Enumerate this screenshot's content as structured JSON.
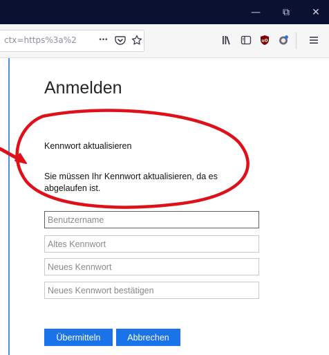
{
  "window": {
    "minimize_glyph": "—",
    "maximize_glyph": "⧉",
    "close_glyph": "✕"
  },
  "nav": {
    "url_text": "ctx=https%3a%2",
    "more_glyph": "•••",
    "icons": [
      "pocket-icon",
      "bookmark-star-icon",
      "library-icon",
      "sidebar-icon",
      "ublock-icon",
      "extension-icon",
      "menu-icon"
    ]
  },
  "page": {
    "title": "Anmelden",
    "subtitle": "Kennwort aktualisieren",
    "message": "Sie müssen Ihr Kennwort aktualisieren, da es abgelaufen ist.",
    "fields": {
      "username_placeholder": "Benutzername",
      "old_password_placeholder": "Altes Kennwort",
      "new_password_placeholder": "Neues Kennwort",
      "confirm_password_placeholder": "Neues Kennwort bestätigen"
    },
    "buttons": {
      "submit": "Übermitteln",
      "cancel": "Abbrechen"
    }
  },
  "colors": {
    "titlebar": "#0b1130",
    "accent": "#1a73e8",
    "annotation": "#e0101a"
  }
}
